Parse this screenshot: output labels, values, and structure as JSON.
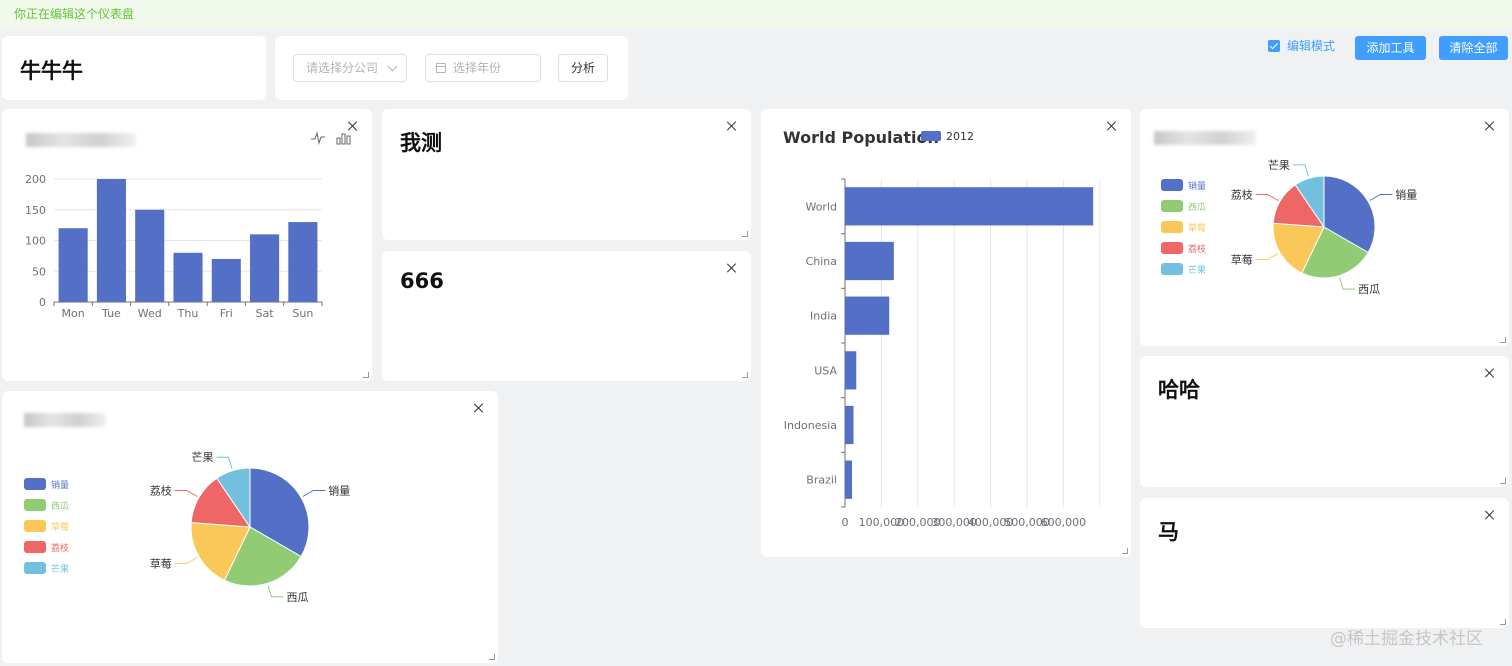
{
  "banner": {
    "text": "你正在编辑这个仪表盘"
  },
  "header": {
    "title": "牛牛牛",
    "company_placeholder": "请选择分公司",
    "year_placeholder": "选择年份",
    "analyze_label": "分析",
    "edit_mode_label": "编辑模式",
    "add_tool_label": "添加工具",
    "clear_all_label": "清除全部"
  },
  "cards": {
    "text1": "我测",
    "text2": "666",
    "text3": "哈哈",
    "text4": "马"
  },
  "chart_data": [
    {
      "type": "bar",
      "categories": [
        "Mon",
        "Tue",
        "Wed",
        "Thu",
        "Fri",
        "Sat",
        "Sun"
      ],
      "values": [
        120,
        200,
        150,
        80,
        70,
        110,
        130
      ],
      "ylim": [
        0,
        200
      ],
      "yticks": [
        0,
        50,
        100,
        150,
        200
      ],
      "color": "#5470c6",
      "grid": true,
      "toolbox": [
        "line-chart-icon",
        "bar-chart-icon"
      ]
    },
    {
      "type": "bar",
      "orientation": "horizontal",
      "title": "World Population",
      "categories": [
        "Brazil",
        "Indonesia",
        "USA",
        "India",
        "China",
        "World"
      ],
      "series": [
        {
          "name": "2012",
          "values": [
            19325,
            23438,
            31000,
            121594,
            134141,
            681807
          ]
        }
      ],
      "xlim": [
        0,
        700000
      ],
      "xticks": [
        "0",
        "100,000",
        "200,000",
        "300,000",
        "400,000",
        "500,000",
        "600,000"
      ],
      "color": "#5470c6",
      "legend": "top"
    },
    {
      "type": "pie",
      "labels": [
        "销量",
        "西瓜",
        "草莓",
        "荔枝",
        "芒果"
      ],
      "values": [
        35,
        25,
        20,
        15,
        10
      ],
      "colors": [
        "#5470c6",
        "#91cc75",
        "#fac858",
        "#ee6666",
        "#73c0de"
      ],
      "legend": "left"
    },
    {
      "type": "pie",
      "labels": [
        "销量",
        "西瓜",
        "草莓",
        "荔枝",
        "芒果"
      ],
      "values": [
        35,
        25,
        20,
        15,
        10
      ],
      "colors": [
        "#5470c6",
        "#91cc75",
        "#fac858",
        "#ee6666",
        "#73c0de"
      ],
      "legend": "left"
    }
  ],
  "watermark": "@稀土掘金技术社区"
}
